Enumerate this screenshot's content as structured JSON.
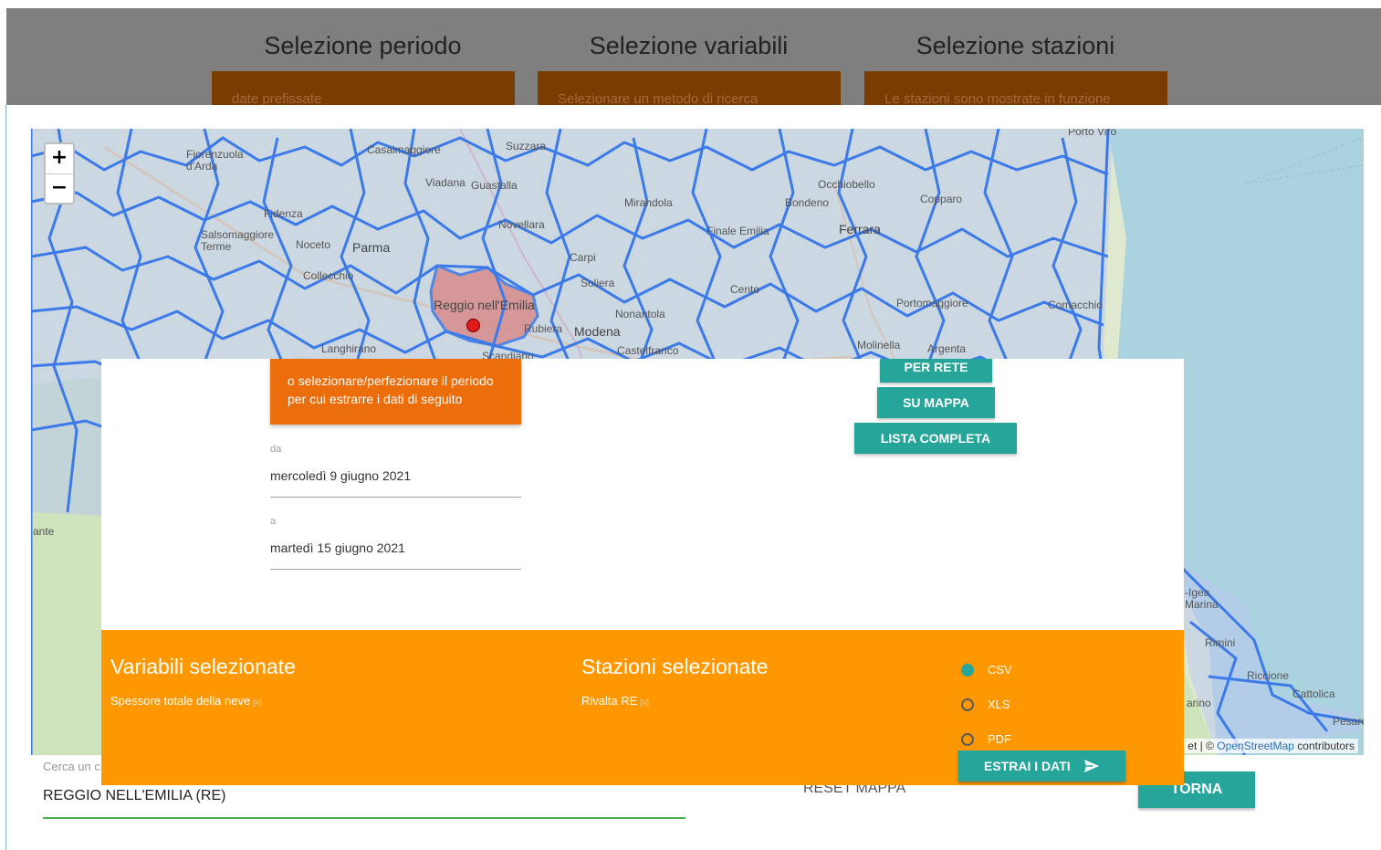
{
  "header": {
    "steps": [
      {
        "title": "Selezione periodo",
        "box_text": "date prefissate"
      },
      {
        "title": "Selezione variabili",
        "box_text": "Selezionare un metodo di ricerca"
      },
      {
        "title": "Selezione stazioni",
        "box_text": "Le stazioni sono mostrate in funzione"
      }
    ]
  },
  "map": {
    "zoom_in": "+",
    "zoom_out": "−",
    "labels": [
      "Casalmaggiore",
      "Suzzara",
      "Viadana",
      "Guastalla",
      "Mirandola",
      "Bondeno",
      "Occhiobello",
      "Copparo",
      "Ferrara",
      "Finale Emilia",
      "Fidenza",
      "Salsomaggiore Terme",
      "Noceto",
      "Parma",
      "Novellara",
      "Carpi",
      "Soliera",
      "Cento",
      "Collecchio",
      "Reggio nell'Emilia",
      "Rubiera",
      "Modena",
      "Nonantola",
      "Portomaggiore",
      "Comacchio",
      "Langhirano",
      "Scandiano",
      "Castelfranco",
      "Molinella",
      "Argenta",
      "Fiorenzuola d'Arda",
      "ante",
      "Rimini",
      "Riccione",
      "Cattolica",
      "Pesaro",
      "Porto Viro",
      "-Igea Marina",
      "arino"
    ],
    "attribution_prefix": "et | © ",
    "attribution_link": "OpenStreetMap",
    "attribution_suffix": " contributors",
    "colors": {
      "boundary": "#3b7ae8",
      "fill": "#b9c9f0",
      "selected_fill": "#d98c8c",
      "station": "#e31a1c",
      "sea": "#aad3df"
    }
  },
  "modal": {
    "hint": "o selezionare/perfezionare il periodo per cui estrarre i dati di seguito",
    "from_label": "da",
    "from_value": "mercoledì 9 giugno 2021",
    "to_label": "a",
    "to_value": "martedì 15 giugno 2021",
    "buttons": {
      "per_rete": "PER RETE",
      "su_mappa": "SU MAPPA",
      "lista_completa": "LISTA COMPLETA"
    }
  },
  "summary": {
    "variables_title": "Variabili selezionate",
    "variables": [
      {
        "name": "Spessore totale della neve",
        "remove": "[x]"
      }
    ],
    "stations_title": "Stazioni selezionate",
    "stations": [
      {
        "name": "Rivalta RE",
        "remove": "[x]"
      }
    ],
    "formats": [
      {
        "label": "CSV",
        "selected": true
      },
      {
        "label": "XLS",
        "selected": false
      },
      {
        "label": "PDF",
        "selected": false
      }
    ],
    "extract_button": "ESTRAI I DATI"
  },
  "bottom": {
    "search_label": "Cerca un c",
    "search_value": "REGGIO NELL'EMILIA (RE)",
    "reset_button": "RESET MAPPA",
    "back_button": "TORNA"
  },
  "theme": {
    "teal": "#26a69a",
    "orange": "#ff9800",
    "dark_orange": "#ec6d0c",
    "header_gray": "#7f7f7f"
  }
}
